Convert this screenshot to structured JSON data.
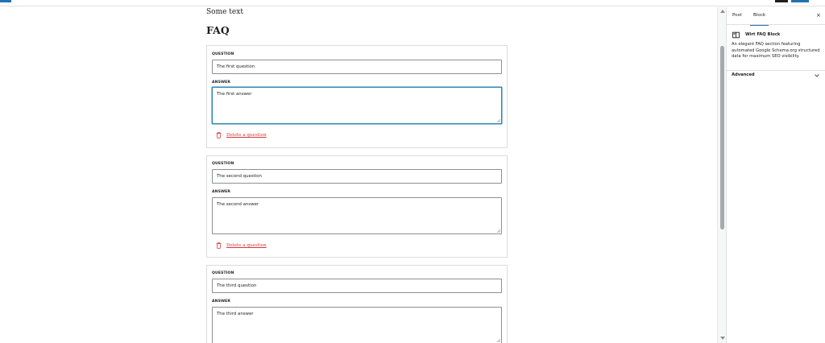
{
  "editor": {
    "paragraph_text": "Some text",
    "heading": "FAQ",
    "question_label": "QUESTION",
    "answer_label": "ANSWER",
    "delete_label": "Delete a question",
    "faq_items": [
      {
        "question": "The first question",
        "answer": "The first answer"
      },
      {
        "question": "The second question",
        "answer": "The second answer"
      },
      {
        "question": "The third question",
        "answer": "The third answer"
      }
    ]
  },
  "sidebar": {
    "tabs": [
      {
        "label": "Post",
        "active": false
      },
      {
        "label": "Block",
        "active": true
      }
    ],
    "close_glyph": "×",
    "block": {
      "icon": "faq-block-icon",
      "title": "Wirt FAQ Block",
      "description": "An elegant FAQ section featuring automated Google Schema.org structured data for maximum SEO visibility."
    },
    "panels": [
      {
        "label": "Advanced",
        "icon": "chevron-down-icon"
      }
    ]
  },
  "colors": {
    "accent": "#2271b1",
    "focus": "#2b86b6",
    "danger": "#d63638",
    "border": "#dcdcde"
  }
}
